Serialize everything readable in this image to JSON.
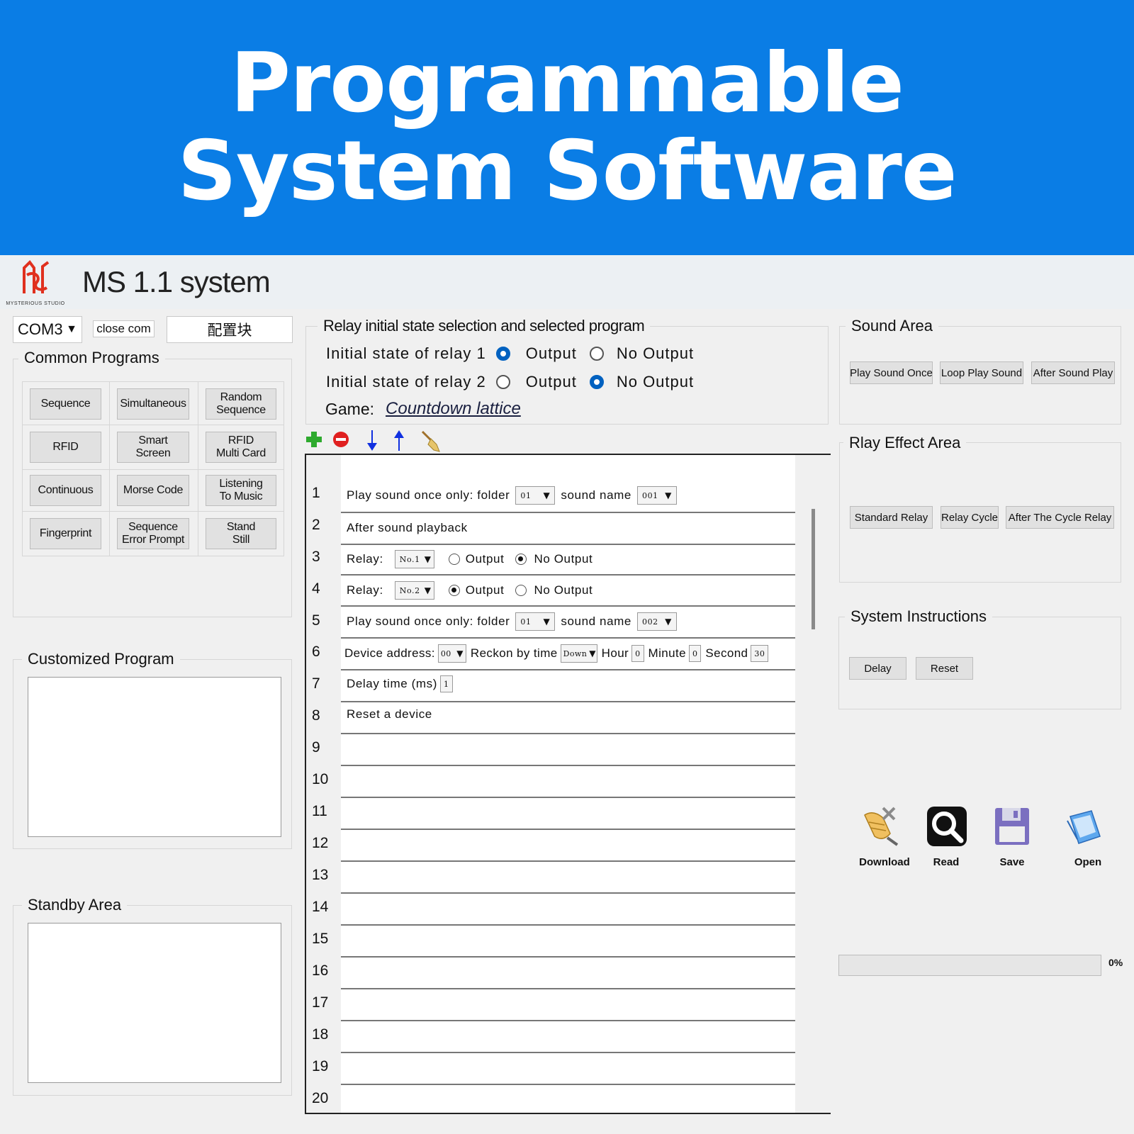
{
  "banner": {
    "line1": "Programmable",
    "line2": "System Software"
  },
  "app": {
    "logo_text": "MYSTERIOUS STUDIO",
    "title": "MS 1.1 system"
  },
  "connection": {
    "port": "COM3",
    "close_label": "close com",
    "config_label": "配置块"
  },
  "common_programs": {
    "title": "Common Programs",
    "buttons": [
      [
        "Sequence",
        "Simultaneous",
        "Random\nSequence"
      ],
      [
        "RFID",
        "Smart\nScreen",
        "RFID\nMulti Card"
      ],
      [
        "Continuous",
        "Morse Code",
        "Listening\nTo Music"
      ],
      [
        "Fingerprint",
        "Sequence\nError Prompt",
        "Stand\nStill"
      ]
    ]
  },
  "customized_program": {
    "title": "Customized Program"
  },
  "standby_area": {
    "title": "Standby Area"
  },
  "relay_section": {
    "title": "Relay initial state selection and selected program",
    "relay1_label": "Initial state of relay 1",
    "relay2_label": "Initial state of relay 2",
    "output_label": "Output",
    "no_output_label": "No Output",
    "relay1_selected": "Output",
    "relay2_selected": "No Output",
    "game_label": "Game:",
    "game_name": "Countdown lattice"
  },
  "toolbar_icons": [
    "add-icon",
    "remove-icon",
    "move-down-icon",
    "move-up-icon",
    "clear-broom-icon"
  ],
  "program_rows": {
    "numbers": [
      "1",
      "2",
      "3",
      "4",
      "5",
      "6",
      "7",
      "8",
      "9",
      "10",
      "11",
      "12",
      "13",
      "14",
      "15",
      "16",
      "17",
      "18",
      "19",
      "20"
    ],
    "row1": {
      "label": "Play sound once only: folder",
      "folder": "01",
      "sound_label": "sound name",
      "sound": "001"
    },
    "row2": {
      "label": "After sound playback"
    },
    "row3": {
      "label": "Relay:",
      "relay": "No.1",
      "output": "Output",
      "no_output": "No Output",
      "selected": "No Output"
    },
    "row4": {
      "label": "Relay:",
      "relay": "No.2",
      "output": "Output",
      "no_output": "No Output",
      "selected": "Output"
    },
    "row5": {
      "label": "Play sound once only: folder",
      "folder": "01",
      "sound_label": "sound name",
      "sound": "002"
    },
    "row6": {
      "device_label": "Device address:",
      "device": "00",
      "reckon_label": "Reckon by time",
      "reckon": "Down",
      "hour_label": "Hour",
      "hour": "0",
      "minute_label": "Minute",
      "minute": "0",
      "second_label": "Second",
      "second": "30"
    },
    "row7": {
      "label": "Delay time (ms)",
      "value": "1"
    },
    "row8": {
      "label": "Reset a device"
    }
  },
  "sound_area": {
    "title": "Sound Area",
    "buttons": [
      "Play Sound Once",
      "Loop Play Sound",
      "After Sound Play"
    ]
  },
  "relay_effect_area": {
    "title": "Rlay Effect Area",
    "buttons": [
      "Standard Relay",
      "Relay Cycle",
      "After The Cycle Relay"
    ]
  },
  "system_instructions": {
    "title": "System Instructions",
    "buttons": [
      "Delay",
      "Reset"
    ]
  },
  "actions": {
    "download": "Download",
    "read": "Read",
    "save": "Save",
    "open": "Open"
  },
  "progress": {
    "value": 0,
    "label": "0%"
  },
  "colors": {
    "banner": "#0a7de5",
    "radio_selected": "#0061c0",
    "add": "#2eaa2e",
    "remove": "#e02020",
    "arrows": "#1030e0"
  }
}
